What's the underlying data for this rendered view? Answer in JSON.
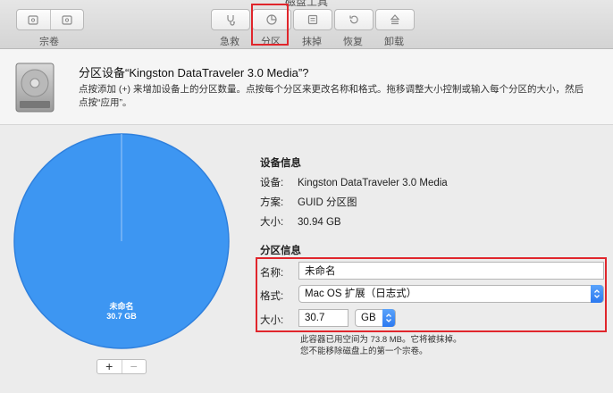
{
  "window": {
    "title": "磁盘工具"
  },
  "toolbar": {
    "volume_label": "宗卷",
    "buttons": [
      {
        "label": "急救",
        "icon": "stethoscope-icon"
      },
      {
        "label": "分区",
        "icon": "partition-icon"
      },
      {
        "label": "抹掉",
        "icon": "erase-icon"
      },
      {
        "label": "恢复",
        "icon": "restore-icon"
      },
      {
        "label": "卸载",
        "icon": "unmount-icon"
      }
    ],
    "highlight_color": "#e0262c"
  },
  "header": {
    "title": "分区设备“Kingston DataTraveler 3.0 Media”?",
    "description": "点按添加 (+) 来增加设备上的分区数量。点按每个分区来更改名称和格式。拖移调整大小控制或输入每个分区的大小，然后点按“应用”。"
  },
  "pie": {
    "partition_name": "未命名",
    "partition_size": "30.7 GB",
    "fill_color": "#3d96f2",
    "add_label": "+",
    "remove_label": "−"
  },
  "device_info": {
    "section_title": "设备信息",
    "rows": [
      {
        "key": "设备:",
        "value": "Kingston DataTraveler 3.0 Media"
      },
      {
        "key": "方案:",
        "value": "GUID 分区图"
      },
      {
        "key": "大小:",
        "value": "30.94 GB"
      }
    ]
  },
  "partition_info": {
    "section_title": "分区信息",
    "name_label": "名称:",
    "name_value": "未命名",
    "format_label": "格式:",
    "format_value": "Mac OS 扩展（日志式）",
    "size_label": "大小:",
    "size_value": "30.7",
    "unit_value": "GB",
    "note_line1": "此容器已用空间为 73.8 MB。它将被抹掉。",
    "note_line2": "您不能移除磁盘上的第一个宗卷。"
  }
}
